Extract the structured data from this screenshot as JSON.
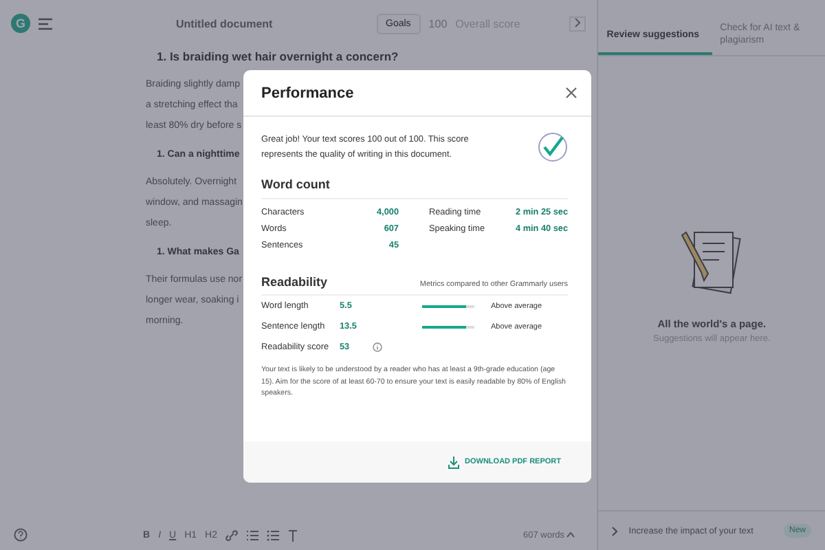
{
  "topbar": {
    "logo_letter": "G",
    "doc_title": "Untitled document",
    "goals_button": "Goals",
    "score": "100",
    "score_label": "Overall score"
  },
  "document": {
    "blocks": [
      {
        "kind": "heading",
        "text": "1. Is braiding wet hair overnight a concern?"
      },
      {
        "kind": "para",
        "lines": [
          "Braiding slightly damp",
          "a stretching effect tha",
          "least 80% dry before s"
        ]
      },
      {
        "kind": "heading",
        "text": "1. Can a nighttime"
      },
      {
        "kind": "para",
        "lines": [
          "Absolutely. Overnight",
          "window, and massagin",
          "sleep."
        ]
      },
      {
        "kind": "heading",
        "text": "1. What makes Ga"
      },
      {
        "kind": "para",
        "lines": [
          "Their formulas use nor",
          "longer wear, soaking i",
          "morning."
        ]
      }
    ]
  },
  "toolbar": {
    "buttons": [
      "B",
      "I",
      "U",
      "H1",
      "H2"
    ],
    "word_count": "607 words"
  },
  "side_panel": {
    "tabs": [
      {
        "label": "Review suggestions",
        "selected": true
      },
      {
        "label": "Check for AI text & plagiarism",
        "selected": false
      }
    ],
    "empty_title": "All the world's a page.",
    "empty_subtitle": "Suggestions will appear here.",
    "footer_text": "Increase the impact of your text",
    "footer_badge": "New"
  },
  "modal": {
    "title": "Performance",
    "summary": "Great job! Your text scores 100 out of 100. This score represents the quality of writing in this document.",
    "word_count": {
      "title": "Word count",
      "left": [
        {
          "label": "Characters",
          "value": "4,000"
        },
        {
          "label": "Words",
          "value": "607"
        },
        {
          "label": "Sentences",
          "value": "45"
        }
      ],
      "right": [
        {
          "label": "Reading time",
          "value": "2 min 25 sec"
        },
        {
          "label": "Speaking time",
          "value": "4 min 40 sec"
        }
      ]
    },
    "readability": {
      "title": "Readability",
      "note": "Metrics compared to other Grammarly users",
      "metrics": [
        {
          "label": "Word length",
          "value": "5.5",
          "level": 0.85,
          "rating": "Above average"
        },
        {
          "label": "Sentence length",
          "value": "13.5",
          "level": 0.85,
          "rating": "Above average"
        },
        {
          "label": "Readability score",
          "value": "53"
        }
      ],
      "description": "Your text is likely to be understood by a reader who has at least a 9th-grade education (age 15). Aim for the score of at least 60-70 to ensure your text is easily readable by 80% of English speakers."
    },
    "download_button": "DOWNLOAD PDF REPORT"
  }
}
